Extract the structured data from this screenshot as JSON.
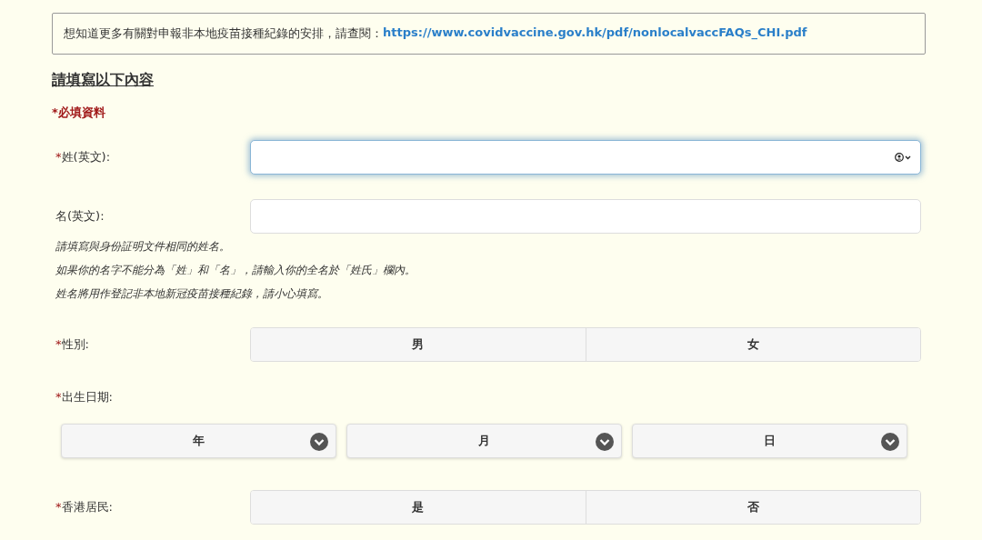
{
  "notice": {
    "text": "想知道更多有關對申報非本地疫苗接種紀錄的安排，請查閱：",
    "link": "https://www.covidvaccine.gov.hk/pdf/nonlocalvaccFAQs_CHI.pdf"
  },
  "heading": "請填寫以下內容",
  "required_note": "*必填資料",
  "name_fields": [
    {
      "mark": "*",
      "label": "姓(英文):",
      "focused": true
    },
    {
      "label": "名(英文):",
      "focused": false
    }
  ],
  "name_notes": [
    "請填寫與身份証明文件相同的姓名。",
    "如果你的名字不能分為「姓」和「名」，請輸入你的全名於「姓氏」欄內。",
    "姓名將用作登記非本地新冠疫苗接種紀錄，請小心填寫。"
  ],
  "gender": {
    "mark": "*",
    "label": "性別:",
    "options": [
      {
        "label": "男",
        "selected": false
      },
      {
        "label": "女",
        "selected": false
      }
    ]
  },
  "birth_date": {
    "mark": "*",
    "label": "出生日期:",
    "selects": [
      "年",
      "月",
      "日"
    ]
  },
  "hk_resident": {
    "mark": "*",
    "label": "香港居民:",
    "options": [
      {
        "label": "是",
        "selected": false
      },
      {
        "label": "否",
        "selected": false
      }
    ]
  }
}
